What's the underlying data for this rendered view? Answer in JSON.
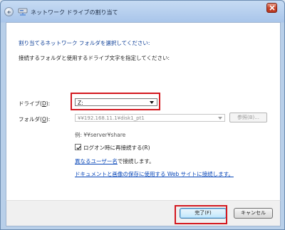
{
  "window": {
    "title": "ネットワーク ドライブの割り当て",
    "back_icon": "back-arrow-icon",
    "title_icon": "network-drive-icon",
    "close_icon": "close-icon"
  },
  "content": {
    "instruction": "割り当てるネットワーク フォルダを選択してください:",
    "description": "接続するフォルダと使用するドライブ文字を指定してください:",
    "drive_label_pre": "ドライブ(",
    "drive_label_key": "D",
    "drive_label_post": "):",
    "drive_value": "Z:",
    "folder_label_pre": "フォルダ(",
    "folder_label_key": "O",
    "folder_label_post": "):",
    "folder_value": "¥¥192.168.11.1¥disk1_pt1",
    "browse_label": "参照(B)...",
    "example": "例: ¥¥server¥share",
    "reconnect_label": "ログオン時に再接続する(R)",
    "reconnect_checked": true,
    "link_user_text": "異なるユーザー名",
    "link_user_suffix": "で接続します。",
    "link_website": "ドキュメントと画像の保存に使用する Web サイトに接続します。"
  },
  "footer": {
    "finish_label": "完了(F)",
    "cancel_label": "キャンセル"
  },
  "colors": {
    "highlight": "#d3181f",
    "link": "#0645b8",
    "instruction": "#0a3c96"
  }
}
